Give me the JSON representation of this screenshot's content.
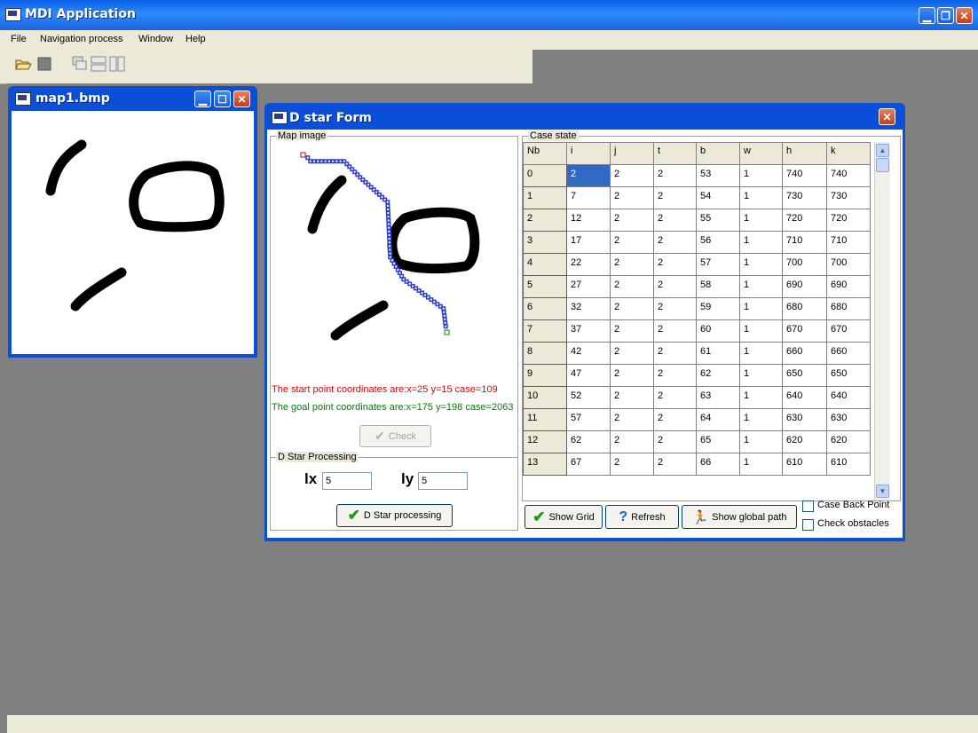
{
  "app": {
    "title": "MDI Application"
  },
  "menu": [
    "File",
    "Navigation process",
    "Window",
    "Help"
  ],
  "toolbar": {
    "buttons": [
      "open-folder-icon",
      "stop-icon",
      "cascade-icon",
      "tile-horizontal-icon",
      "tile-vertical-icon"
    ]
  },
  "map_window": {
    "title": "map1.bmp"
  },
  "dstar_form": {
    "title": "D star Form",
    "map_group_label": "Map image",
    "start_text": "The start point coordinates are:x=25 y=15 case=109",
    "goal_text": "The goal point coordinates are:x=175 y=198 case=2063",
    "check_label": "Check",
    "processing_group_label": "D Star Processing",
    "lx_label": "lx",
    "lx_value": "5",
    "ly_label": "ly",
    "ly_value": "5",
    "dstar_button": "D Star processing",
    "case_state_label": "Case state",
    "table": {
      "headers": [
        "Nb",
        "i",
        "j",
        "t",
        "b",
        "w",
        "h",
        "k"
      ],
      "rows": [
        [
          "0",
          "2",
          "2",
          "2",
          "53",
          "1",
          "740",
          "740"
        ],
        [
          "1",
          "7",
          "2",
          "2",
          "54",
          "1",
          "730",
          "730"
        ],
        [
          "2",
          "12",
          "2",
          "2",
          "55",
          "1",
          "720",
          "720"
        ],
        [
          "3",
          "17",
          "2",
          "2",
          "56",
          "1",
          "710",
          "710"
        ],
        [
          "4",
          "22",
          "2",
          "2",
          "57",
          "1",
          "700",
          "700"
        ],
        [
          "5",
          "27",
          "2",
          "2",
          "58",
          "1",
          "690",
          "690"
        ],
        [
          "6",
          "32",
          "2",
          "2",
          "59",
          "1",
          "680",
          "680"
        ],
        [
          "7",
          "37",
          "2",
          "2",
          "60",
          "1",
          "670",
          "670"
        ],
        [
          "8",
          "42",
          "2",
          "2",
          "61",
          "1",
          "660",
          "660"
        ],
        [
          "9",
          "47",
          "2",
          "2",
          "62",
          "1",
          "650",
          "650"
        ],
        [
          "10",
          "52",
          "2",
          "2",
          "63",
          "1",
          "640",
          "640"
        ],
        [
          "11",
          "57",
          "2",
          "2",
          "64",
          "1",
          "630",
          "630"
        ],
        [
          "12",
          "62",
          "2",
          "2",
          "65",
          "1",
          "620",
          "620"
        ],
        [
          "13",
          "67",
          "2",
          "2",
          "66",
          "1",
          "610",
          "610"
        ]
      ]
    },
    "show_grid": "Show Grid",
    "refresh": "Refresh",
    "show_global_path": "Show global path",
    "case_back_point": "Case Back Point",
    "check_obstacles": "Check obstacles"
  },
  "colors": {
    "start_text": "#e00000",
    "goal_text": "#008000",
    "titlebar": "#0a5ee8",
    "selection": "#316ac5"
  }
}
